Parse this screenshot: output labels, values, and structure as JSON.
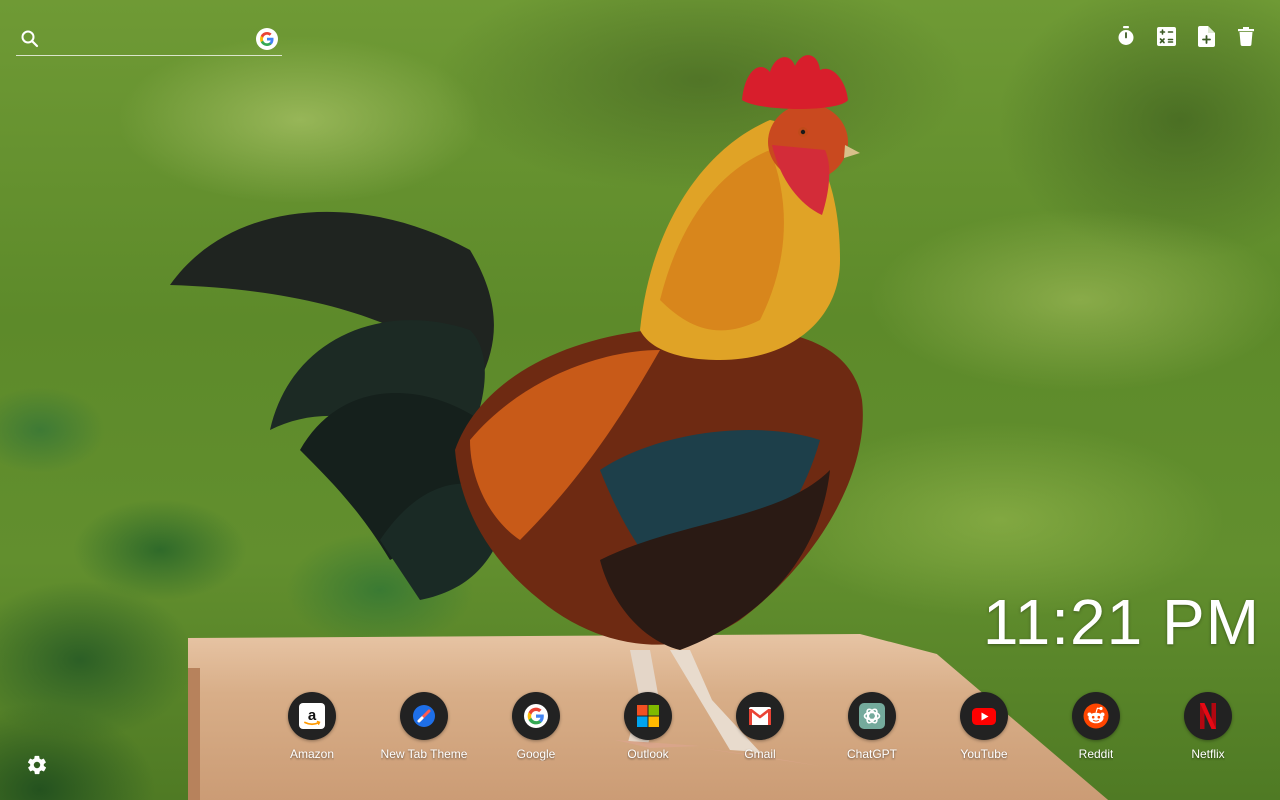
{
  "search": {
    "placeholder": "",
    "search_icon": "search-icon",
    "engine_icon": "google-g-icon"
  },
  "toolbar": [
    {
      "name": "timer-button",
      "icon": "stopwatch-icon"
    },
    {
      "name": "calculator-button",
      "icon": "calculator-icon"
    },
    {
      "name": "new-note-button",
      "icon": "note-add-icon"
    },
    {
      "name": "delete-button",
      "icon": "trash-icon"
    }
  ],
  "clock": {
    "time": "11:21 PM"
  },
  "shortcuts": [
    {
      "label": "Amazon",
      "icon": "amazon-icon"
    },
    {
      "label": "New Tab Theme",
      "icon": "new-tab-theme-icon"
    },
    {
      "label": "Google",
      "icon": "google-icon"
    },
    {
      "label": "Outlook",
      "icon": "microsoft-icon"
    },
    {
      "label": "Gmail",
      "icon": "gmail-icon"
    },
    {
      "label": "ChatGPT",
      "icon": "chatgpt-icon"
    },
    {
      "label": "YouTube",
      "icon": "youtube-icon"
    },
    {
      "label": "Reddit",
      "icon": "reddit-icon"
    },
    {
      "label": "Netflix",
      "icon": "netflix-icon"
    }
  ],
  "settings": {
    "icon": "gear-icon"
  },
  "colors": {
    "tile_bg": "#222222",
    "youtube_red": "#ff0000",
    "reddit_orange": "#ff4500",
    "netflix_red": "#e50914",
    "comb_red": "#d81e2c"
  }
}
